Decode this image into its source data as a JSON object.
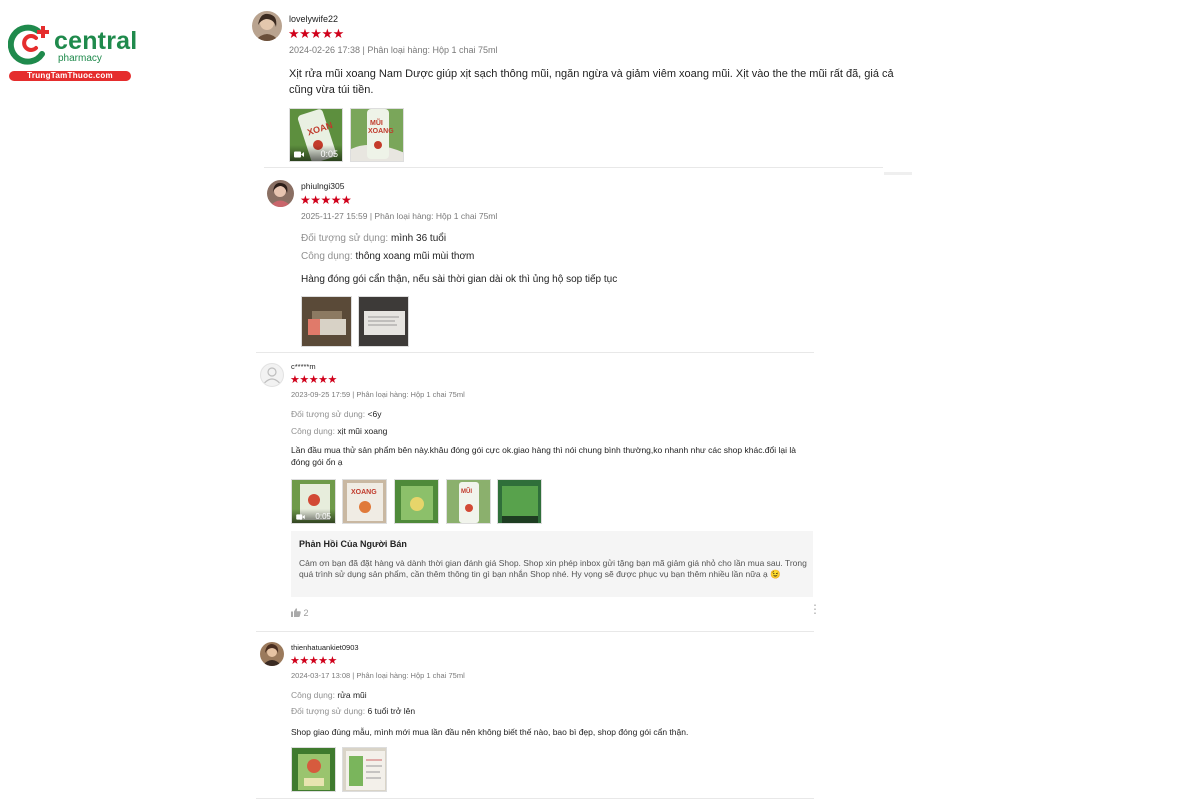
{
  "logo": {
    "brand": "central",
    "sub": "pharmacy",
    "site": "TrungTamThuoc.com"
  },
  "colors": {
    "star": "#d0011b",
    "brand_green": "#1f8a4c",
    "brand_red": "#e52d2d"
  },
  "reviews": [
    {
      "username": "lovelywife22",
      "rating": 5,
      "stars": "★★★★★",
      "meta": "2024-02-26 17:38 | Phân loại hàng: Hộp 1 chai 75ml",
      "comment": "Xịt rửa mũi xoang Nam Dược giúp xịt sạch thông mũi, ngăn ngừa và giảm viêm xoang mũi. Xịt vào the the mũi rất đã, giá cả cũng vừa túi tiền.",
      "media": [
        {
          "type": "video",
          "duration": "0:05"
        },
        {
          "type": "image"
        }
      ]
    },
    {
      "username": "phiulngi305",
      "rating": 5,
      "stars": "★★★★★",
      "meta": "2025-11-27 15:59 | Phân loại hàng: Hộp 1 chai 75ml",
      "attrs": [
        {
          "key": "Đối tượng sử dụng:",
          "value": "mình 36 tuổi"
        },
        {
          "key": "Công dụng:",
          "value": "thông xoang mũi mùi thơm"
        }
      ],
      "comment": "Hàng đóng gói cẩn thận, nếu sài thời gian dài ok thì ủng hộ sop tiếp tục",
      "media": [
        {
          "type": "image"
        },
        {
          "type": "image"
        }
      ]
    },
    {
      "username": "c*****m",
      "rating": 5,
      "stars": "★★★★★",
      "meta": "2023-09-25 17:59 | Phân loại hàng: Hộp 1 chai 75ml",
      "attrs": [
        {
          "key": "Đối tượng sử dụng:",
          "value": "<6y"
        },
        {
          "key": "Công dụng:",
          "value": "xịt mũi xoang"
        }
      ],
      "comment": "Lần đầu mua thử sản phẩm bên này.khâu đóng gói cực ok.giao hàng thì nói chung bình thường,ko nhanh như các shop khác.đổi lại là đóng gói ổn ạ",
      "media": [
        {
          "type": "video",
          "duration": "0:05"
        },
        {
          "type": "image"
        },
        {
          "type": "image"
        },
        {
          "type": "image"
        },
        {
          "type": "image"
        }
      ],
      "seller_reply": {
        "title": "Phản Hồi Của Người Bán",
        "body": "Cảm ơn bạn đã đặt hàng và dành thời gian đánh giá Shop. Shop xin phép inbox gửi tặng bạn mã giảm giá nhỏ cho lần mua sau. Trong quá trình sử dụng sản phẩm, cần thêm thông tin gì bạn nhắn Shop nhé. Hy vọng sẽ được phục vụ bạn thêm nhiều lần nữa ạ 😉"
      },
      "likes": "2"
    },
    {
      "username": "thienhatuankiet0903",
      "rating": 5,
      "stars": "★★★★★",
      "meta": "2024-03-17 13:08 | Phân loại hàng: Hộp 1 chai 75ml",
      "attrs": [
        {
          "key": "Công dụng:",
          "value": "rửa mũi"
        },
        {
          "key": "Đối tượng sử dụng:",
          "value": "6 tuổi trở lên"
        }
      ],
      "comment": "Shop giao đúng mẫu, mình mới mua lần đầu nên không biết thế nào, bao bì đẹp, shop đóng gói cẩn thận.",
      "media": [
        {
          "type": "image"
        },
        {
          "type": "image"
        }
      ]
    }
  ]
}
